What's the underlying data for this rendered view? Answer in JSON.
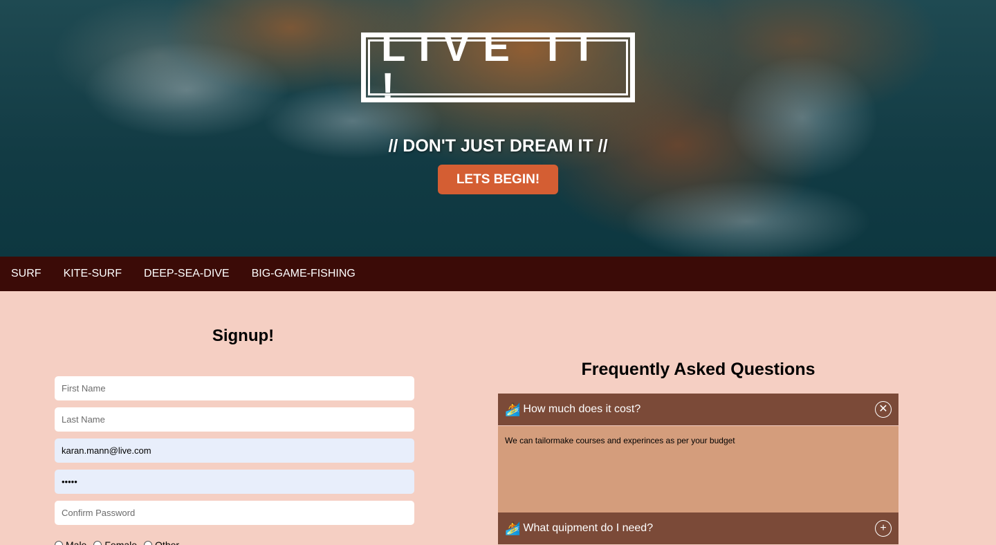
{
  "hero": {
    "logo": "LIVE IT !",
    "tagline": "// DON'T JUST DREAM IT //",
    "cta_label": "LETS BEGIN!"
  },
  "nav": {
    "items": [
      {
        "label": "SURF"
      },
      {
        "label": "KITE-SURF"
      },
      {
        "label": "DEEP-SEA-DIVE"
      },
      {
        "label": "BIG-GAME-FISHING"
      }
    ]
  },
  "signup": {
    "title": "Signup!",
    "first_name_placeholder": "First Name",
    "last_name_placeholder": "Last Name",
    "email_value": "karan.mann@live.com",
    "password_value": "•••••",
    "confirm_placeholder": "Confirm Password",
    "gender_options": [
      "Male",
      "Female",
      "Other"
    ]
  },
  "faq": {
    "title": "Frequently Asked Questions",
    "items": [
      {
        "question": "How much does it cost?",
        "answer": "We can tailormake courses and experinces as per your budget",
        "toggle": "✕"
      },
      {
        "question": "What quipment do I need?",
        "toggle": "+"
      }
    ],
    "icon": "🏄"
  }
}
